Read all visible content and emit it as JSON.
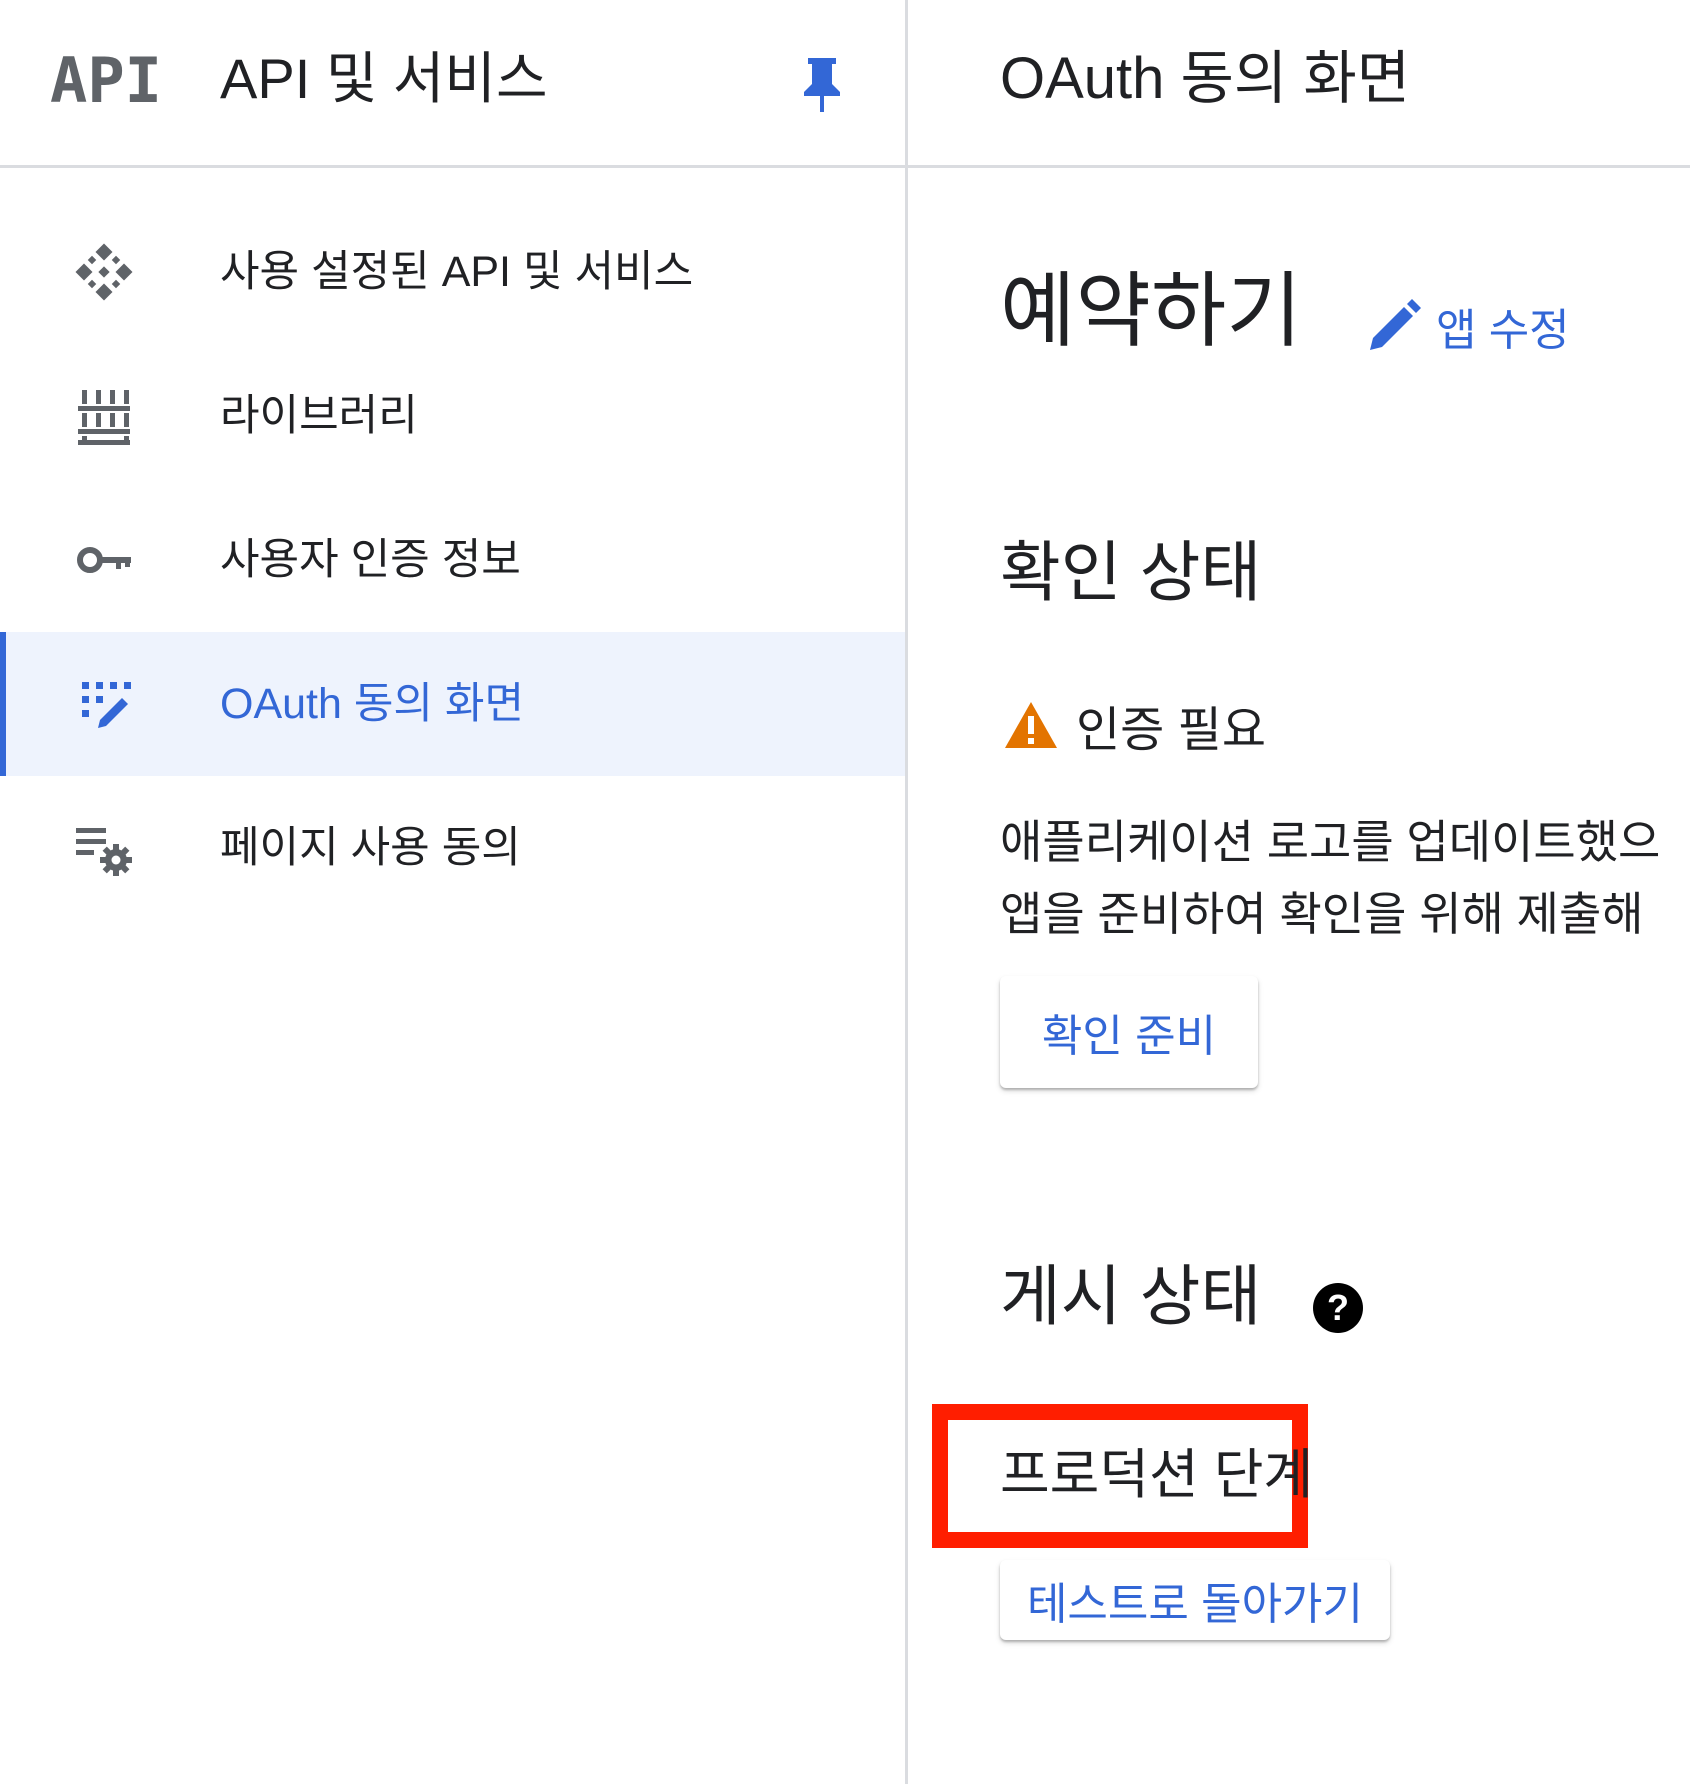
{
  "sidebar": {
    "logo_text": "API",
    "title": "API 및 서비스",
    "items": [
      {
        "label": "사용 설정된 API 및 서비스",
        "icon": "api-diamond-icon"
      },
      {
        "label": "라이브러리",
        "icon": "library-icon"
      },
      {
        "label": "사용자 인증 정보",
        "icon": "key-icon"
      },
      {
        "label": "OAuth 동의 화면",
        "icon": "oauth-consent-icon",
        "active": true
      },
      {
        "label": "페이지 사용 동의",
        "icon": "page-settings-icon"
      }
    ]
  },
  "main": {
    "header_title": "OAuth 동의 화면",
    "app_name": "예약하기",
    "edit_app_label": "앱 수정",
    "verification": {
      "heading": "확인 상태",
      "status": "인증 필요",
      "description_line1": "애플리케이션 로고를 업데이트했으",
      "description_line2": "앱을 준비하여 확인을 위해 제출해",
      "button_label": "확인 준비"
    },
    "publishing": {
      "heading": "게시 상태",
      "status": "프로덕션 단계",
      "button_label": "테스트로 돌아가기"
    }
  },
  "colors": {
    "accent": "#3367d6",
    "active_bg": "#eef3fd",
    "warning": "#e37400",
    "highlight": "#ff1e00",
    "divider": "#dadce0"
  }
}
